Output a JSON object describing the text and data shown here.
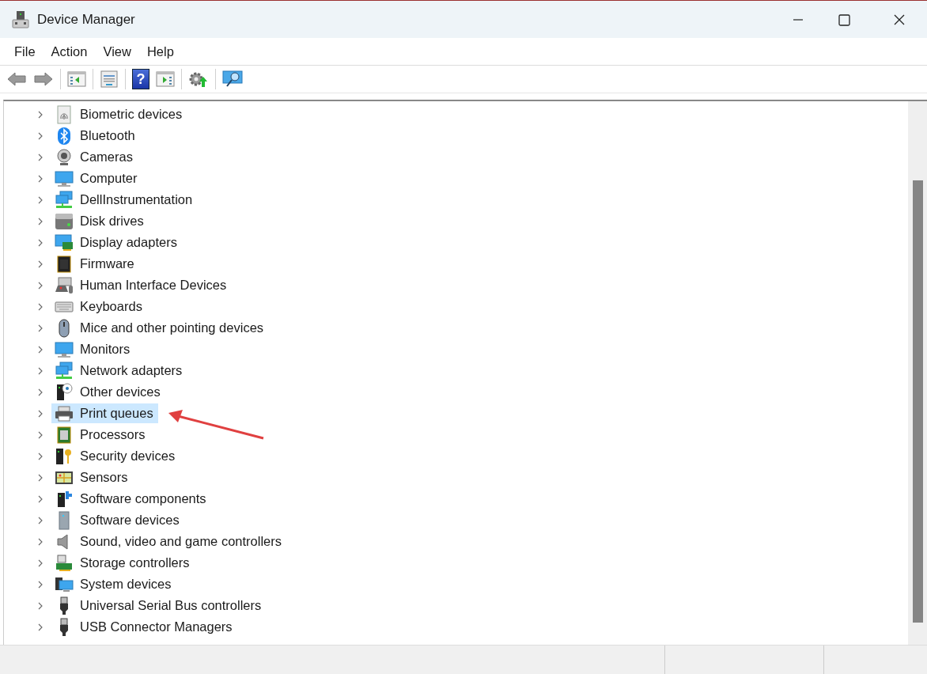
{
  "window": {
    "title": "Device Manager"
  },
  "menu": [
    "File",
    "Action",
    "View",
    "Help"
  ],
  "toolbar": [
    {
      "kind": "back"
    },
    {
      "kind": "forward"
    },
    {
      "kind": "sep"
    },
    {
      "kind": "tree-pane"
    },
    {
      "kind": "sep"
    },
    {
      "kind": "properties"
    },
    {
      "kind": "sep"
    },
    {
      "kind": "help",
      "glyph": "?"
    },
    {
      "kind": "action-pane"
    },
    {
      "kind": "sep"
    },
    {
      "kind": "update"
    },
    {
      "kind": "sep"
    },
    {
      "kind": "scan"
    }
  ],
  "tree": {
    "items": [
      {
        "label": "Biometric devices",
        "kind": "fingerprint",
        "selected": false
      },
      {
        "label": "Bluetooth",
        "kind": "bluetooth",
        "selected": false
      },
      {
        "label": "Cameras",
        "kind": "camera",
        "selected": false
      },
      {
        "label": "Computer",
        "kind": "monitor",
        "selected": false
      },
      {
        "label": "DellInstrumentation",
        "kind": "network",
        "selected": false
      },
      {
        "label": "Disk drives",
        "kind": "disk",
        "selected": false
      },
      {
        "label": "Display adapters",
        "kind": "display",
        "selected": false
      },
      {
        "label": "Firmware",
        "kind": "chip",
        "selected": false
      },
      {
        "label": "Human Interface Devices",
        "kind": "hid",
        "selected": false
      },
      {
        "label": "Keyboards",
        "kind": "keyboard",
        "selected": false
      },
      {
        "label": "Mice and other pointing devices",
        "kind": "mouse",
        "selected": false
      },
      {
        "label": "Monitors",
        "kind": "monitor",
        "selected": false
      },
      {
        "label": "Network adapters",
        "kind": "network",
        "selected": false
      },
      {
        "label": "Other devices",
        "kind": "other",
        "selected": false
      },
      {
        "label": "Print queues",
        "kind": "printer",
        "selected": true
      },
      {
        "label": "Processors",
        "kind": "processor",
        "selected": false
      },
      {
        "label": "Security devices",
        "kind": "security",
        "selected": false
      },
      {
        "label": "Sensors",
        "kind": "sensor",
        "selected": false
      },
      {
        "label": "Software components",
        "kind": "component",
        "selected": false
      },
      {
        "label": "Software devices",
        "kind": "softdevice",
        "selected": false
      },
      {
        "label": "Sound, video and game controllers",
        "kind": "speaker",
        "selected": false
      },
      {
        "label": "Storage controllers",
        "kind": "storage",
        "selected": false
      },
      {
        "label": "System devices",
        "kind": "system",
        "selected": false
      },
      {
        "label": "Universal Serial Bus controllers",
        "kind": "usb",
        "selected": false
      },
      {
        "label": "USB Connector Managers",
        "kind": "usb",
        "selected": false
      }
    ]
  }
}
